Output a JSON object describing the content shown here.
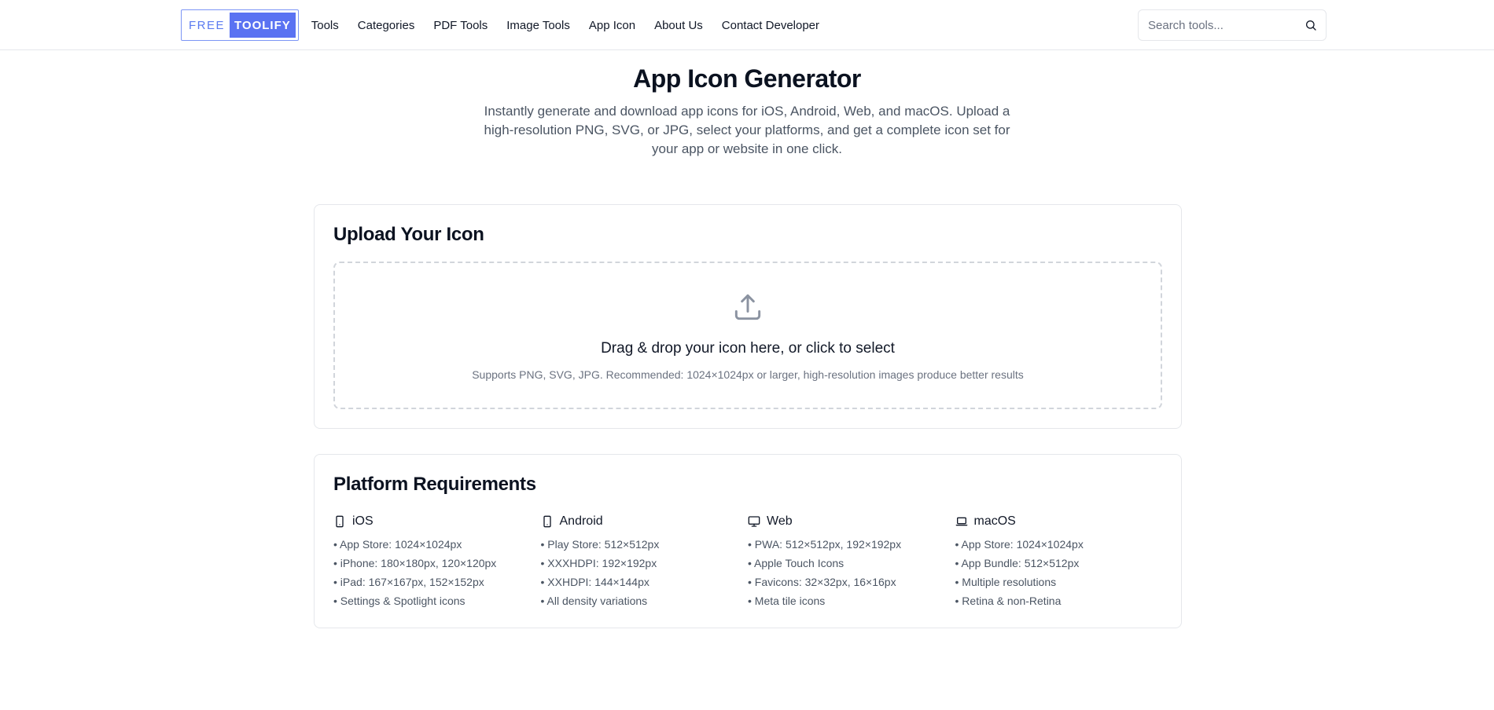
{
  "header": {
    "logo": {
      "left": "FREE",
      "right": "TOOLIFY"
    },
    "nav": [
      "Tools",
      "Categories",
      "PDF Tools",
      "Image Tools",
      "App Icon",
      "About Us",
      "Contact Developer"
    ],
    "search": {
      "placeholder": "Search tools...",
      "icon": "search-icon"
    }
  },
  "hero": {
    "title": "App Icon Generator",
    "description": "Instantly generate and download app icons for iOS, Android, Web, and macOS. Upload a high-resolution PNG, SVG, or JPG, select your platforms, and get a complete icon set for your app or website in one click."
  },
  "upload": {
    "title": "Upload Your Icon",
    "icon": "upload-icon",
    "drop_title": "Drag & drop your icon here, or click to select",
    "drop_hint": "Supports PNG, SVG, JPG. Recommended: 1024×1024px or larger, high-resolution images produce better results"
  },
  "platforms": {
    "title": "Platform Requirements",
    "items": [
      {
        "name": "iOS",
        "icon": "smartphone-icon",
        "details": [
          "App Store: 1024×1024px",
          "iPhone: 180×180px, 120×120px",
          "iPad: 167×167px, 152×152px",
          "Settings & Spotlight icons"
        ]
      },
      {
        "name": "Android",
        "icon": "smartphone-icon",
        "details": [
          "Play Store: 512×512px",
          "XXXHDPI: 192×192px",
          "XXHDPI: 144×144px",
          "All density variations"
        ]
      },
      {
        "name": "Web",
        "icon": "monitor-icon",
        "details": [
          "PWA: 512×512px, 192×192px",
          "Apple Touch Icons",
          "Favicons: 32×32px, 16×16px",
          "Meta tile icons"
        ]
      },
      {
        "name": "macOS",
        "icon": "laptop-icon",
        "details": [
          "App Store: 1024×1024px",
          "App Bundle: 512×512px",
          "Multiple resolutions",
          "Retina & non-Retina"
        ]
      }
    ]
  },
  "colors": {
    "brand": "#5a72f2",
    "text": "#0f172a",
    "muted": "#4b5563",
    "border": "#e5e7eb"
  }
}
